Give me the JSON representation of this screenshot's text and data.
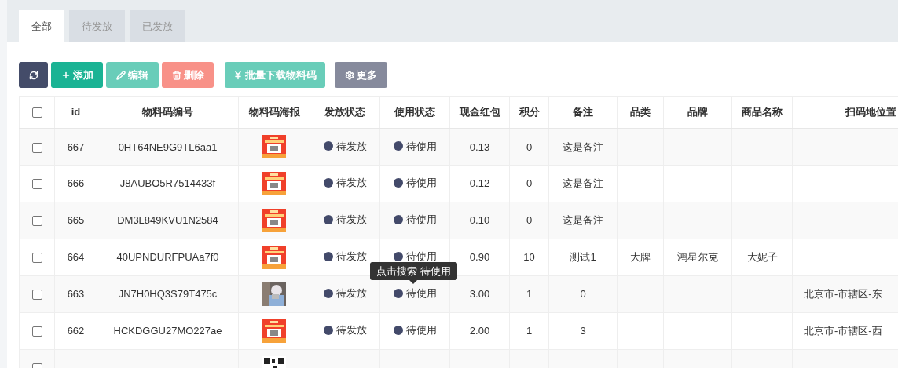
{
  "tabs": [
    {
      "label": "全部",
      "selected": true
    },
    {
      "label": "待发放",
      "selected": false
    },
    {
      "label": "已发放",
      "selected": false
    }
  ],
  "toolbar": [
    {
      "kind": "refresh",
      "disabled": false
    },
    {
      "kind": "add",
      "label": "添加",
      "disabled": false
    },
    {
      "kind": "edit",
      "label": "编辑",
      "disabled": true
    },
    {
      "kind": "delete",
      "label": "删除",
      "disabled": true
    },
    {
      "kind": "download",
      "label": "批量下载物料码",
      "disabled": true
    },
    {
      "kind": "more",
      "label": "更多",
      "disabled": false
    }
  ],
  "table": {
    "select_all": {
      "checked": false
    },
    "columns": [
      "id",
      "物料码编号",
      "物料码海报",
      "发放状态",
      "使用状态",
      "现金红包",
      "积分",
      "备注",
      "品类",
      "品牌",
      "商品名称",
      "扫码地位置"
    ],
    "rows": [
      {
        "checked": false,
        "id": "667",
        "code": "0HT64NE9G9TL6aa1",
        "poster": {
          "kind": "poster"
        },
        "issue_status": "待发放",
        "use_status": "待使用",
        "cash": "0.13",
        "points": "0",
        "note": "这是备注"
      },
      {
        "checked": false,
        "id": "666",
        "code": "J8AUBO5R7514433f",
        "poster": {
          "kind": "poster"
        },
        "issue_status": "待发放",
        "use_status": "待使用",
        "cash": "0.12",
        "points": "0",
        "note": "这是备注"
      },
      {
        "checked": false,
        "id": "665",
        "code": "DM3L849KVU1N2584",
        "poster": {
          "kind": "poster"
        },
        "issue_status": "待发放",
        "use_status": "待使用",
        "cash": "0.10",
        "points": "0",
        "note": "这是备注"
      },
      {
        "checked": false,
        "id": "664",
        "code": "40UPNDURFPUAa7f0",
        "poster": {
          "kind": "poster"
        },
        "issue_status": "待发放",
        "use_status": "待使用",
        "cash": "0.90",
        "points": "10",
        "note": "测试1",
        "category": "大牌",
        "brand": "鸿星尔克",
        "product": "大妮子"
      },
      {
        "checked": false,
        "id": "663",
        "code": "JN7H0HQ3S79T475c",
        "issue_status": "待发放",
        "use_status": "待使用",
        "cash": "3.00",
        "points": "1",
        "note": "0",
        "location": "北京市-市辖区-东"
      },
      {
        "checked": false,
        "id": "662",
        "code": "HCKDGGU27MO227ae",
        "poster": {
          "kind": "poster"
        },
        "issue_status": "待发放",
        "use_status": "待使用",
        "cash": "2.00",
        "points": "1",
        "note": "3",
        "location": "北京市-市辖区-西"
      },
      {
        "checked": false,
        "poster": {
          "kind": "qr"
        }
      }
    ]
  },
  "tooltip": {
    "text": "点击搜索 待使用"
  }
}
